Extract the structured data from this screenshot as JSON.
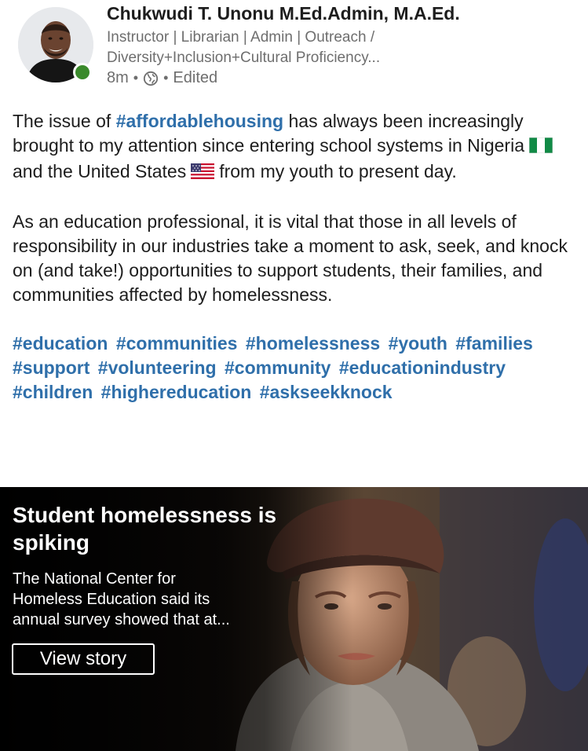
{
  "post": {
    "author": {
      "name": "Chukwudi T. Unonu M.Ed.Admin, M.A.Ed.",
      "headline_lines": [
        "Instructor | Librarian | Admin | Outreach /",
        "Diversity+Inclusion+Cultural Proficiency..."
      ],
      "online": true,
      "presence_color": "#3a8a2b"
    },
    "meta": {
      "time": "8m",
      "sep1": "•",
      "visibility_icon": "globe-icon",
      "sep2": "•",
      "edited": "Edited"
    },
    "body": {
      "p1": {
        "t1": "The issue of ",
        "hashtag": "#affordablehousing",
        "t2": " has always been increasingly brought to my attention since entering school systems in Nigeria",
        "flag1": "nigeria-flag",
        "t3": "and the United States",
        "flag2": "united-states-flag",
        "t4": "from my youth to present day."
      },
      "p2": "As an education professional, it is vital that those in all levels of responsibility in our industries take a moment to ask, seek, and knock on (and take!) opportunities to support students, their families, and communities affected by homelessness.",
      "hashtags": [
        "#education",
        "#communities",
        "#homelessness",
        "#youth",
        "#families",
        "#support",
        "#volunteering",
        "#community",
        "#educationindustry",
        "#children",
        "#highereducation",
        "#askseekknock"
      ]
    },
    "link_card": {
      "title": "Student homelessness is spiking",
      "description_lines": [
        "The National Center for",
        "Homeless Education said its",
        "annual survey showed that at..."
      ],
      "button_label": "View story"
    },
    "colors": {
      "link": "#2f6faa",
      "text": "#1d1d1d",
      "secondary": "#6e6e6e"
    }
  }
}
